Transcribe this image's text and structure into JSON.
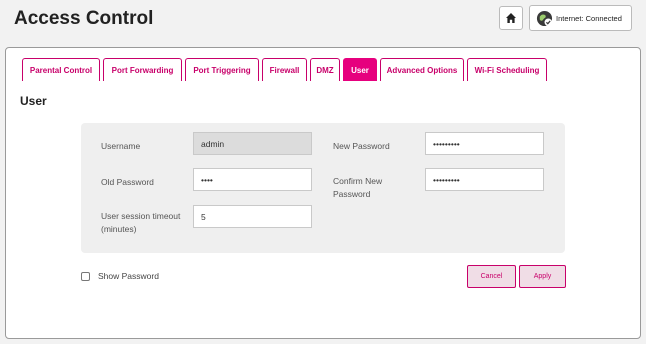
{
  "header": {
    "title": "Access Control",
    "internet_label": "Internet:",
    "internet_status": "Connected"
  },
  "tabs": [
    {
      "label": "Parental Control",
      "active": false
    },
    {
      "label": "Port Forwarding",
      "active": false
    },
    {
      "label": "Port Triggering",
      "active": false
    },
    {
      "label": "Firewall",
      "active": false
    },
    {
      "label": "DMZ",
      "active": false
    },
    {
      "label": "User",
      "active": true
    },
    {
      "label": "Advanced Options",
      "active": false
    },
    {
      "label": "Wi-Fi Scheduling",
      "active": false
    }
  ],
  "section": {
    "title": "User"
  },
  "form": {
    "username_label": "Username",
    "username_value": "admin",
    "old_password_label": "Old Password",
    "old_password_value": "••••",
    "session_timeout_label": "User session timeout (minutes)",
    "session_timeout_value": "5",
    "new_password_label": "New Password",
    "new_password_value": "•••••••••",
    "confirm_password_label": "Confirm New Password",
    "confirm_password_value": "•••••••••"
  },
  "show_password_label": "Show Password",
  "show_password_checked": false,
  "buttons": {
    "cancel": "Cancel",
    "apply": "Apply"
  },
  "colors": {
    "accent": "#e6007e",
    "accent_dark": "#c8006a"
  }
}
